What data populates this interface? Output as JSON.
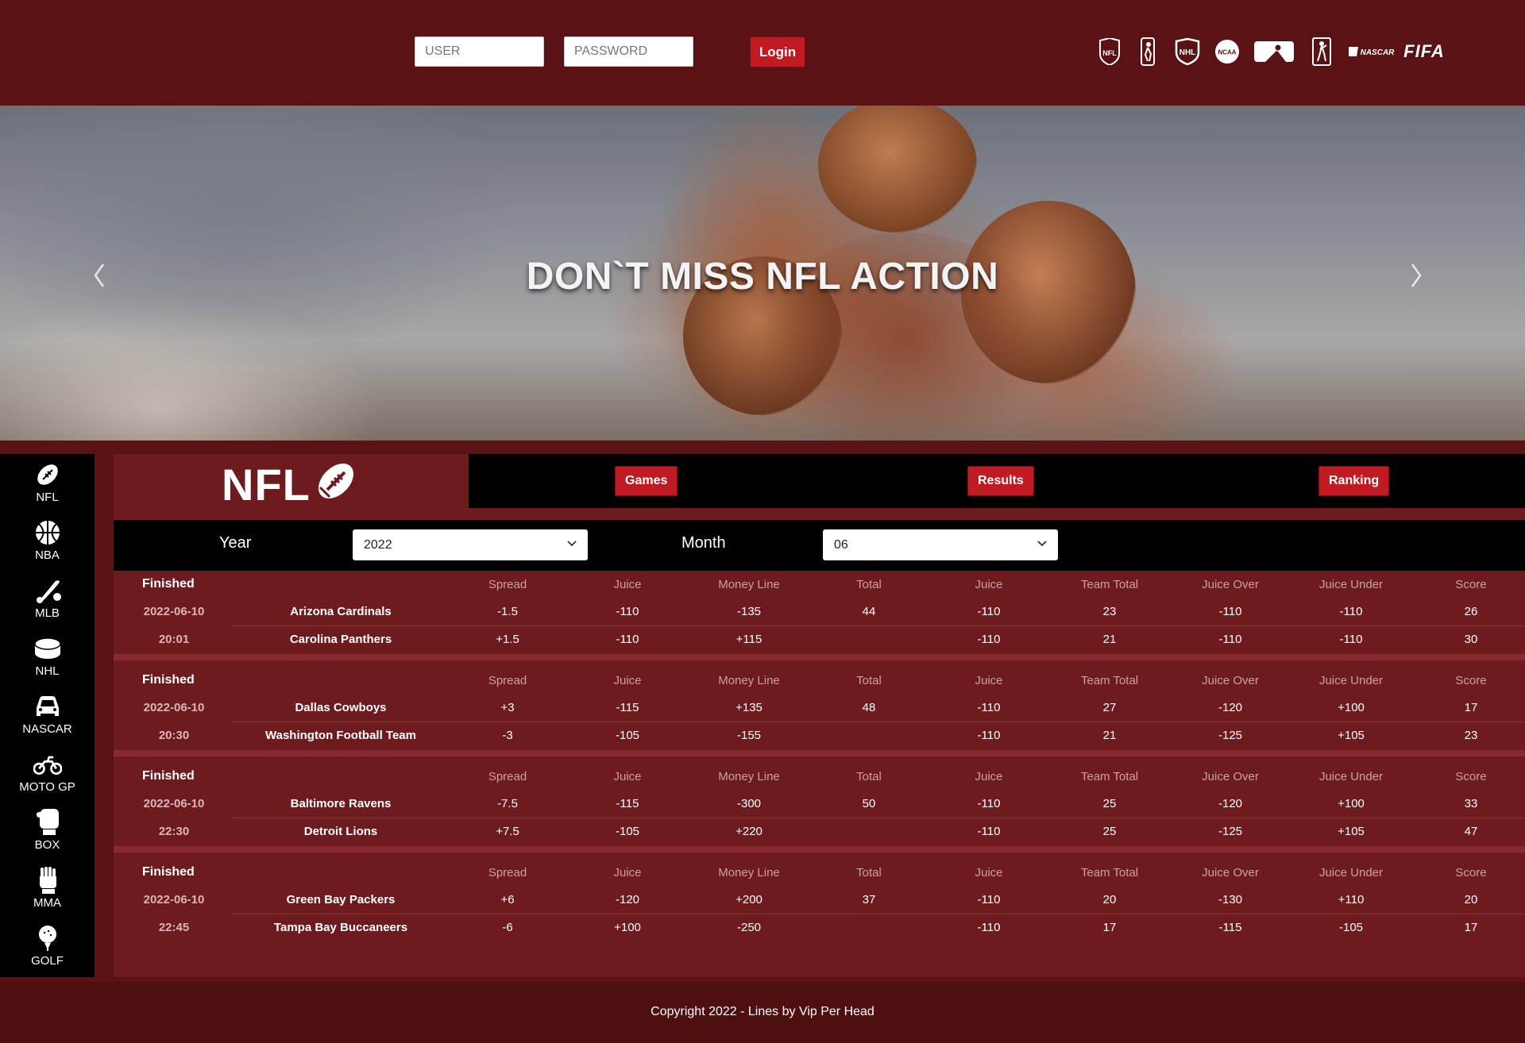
{
  "login": {
    "user_placeholder": "USER",
    "password_placeholder": "PASSWORD",
    "login_label": "Login"
  },
  "league_logos": [
    "nfl-logo",
    "nba-logo",
    "nhl-logo",
    "ncaa-logo",
    "mlb-logo",
    "pga-logo",
    "nascar-logo",
    "fifa-logo"
  ],
  "league_logo_text": {
    "fifa": "FIFA",
    "ncaa": "NCAA",
    "nascar": "NASCAR"
  },
  "hero": {
    "title": "DON`T MISS NFL ACTION"
  },
  "sidebar": {
    "items": [
      {
        "label": "NFL",
        "icon": "football-icon"
      },
      {
        "label": "NBA",
        "icon": "basketball-icon"
      },
      {
        "label": "MLB",
        "icon": "baseball-icon"
      },
      {
        "label": "NHL",
        "icon": "hockey-puck-icon"
      },
      {
        "label": "NASCAR",
        "icon": "car-icon"
      },
      {
        "label": "MOTO GP",
        "icon": "motorcycle-icon"
      },
      {
        "label": "BOX",
        "icon": "boxing-glove-icon"
      },
      {
        "label": "MMA",
        "icon": "mma-glove-icon"
      },
      {
        "label": "GOLF",
        "icon": "golf-ball-icon"
      }
    ]
  },
  "panel": {
    "league_title": "NFL",
    "tabs": [
      "Games",
      "Results",
      "Ranking"
    ],
    "filters": {
      "year_label": "Year",
      "year_value": "2022",
      "month_label": "Month",
      "month_value": "06"
    },
    "columns": [
      "Spread",
      "Juice",
      "Money Line",
      "Total",
      "Juice",
      "Team Total",
      "Juice Over",
      "Juice Under",
      "Score"
    ],
    "games": [
      {
        "status": "Finished",
        "date": "2022-06-10",
        "time": "20:01",
        "teams": [
          {
            "name": "Arizona Cardinals",
            "values": [
              "-1.5",
              "-110",
              "-135",
              "44",
              "-110",
              "23",
              "-110",
              "-110",
              "26"
            ]
          },
          {
            "name": "Carolina Panthers",
            "values": [
              "+1.5",
              "-110",
              "+115",
              "",
              "-110",
              "21",
              "-110",
              "-110",
              "30"
            ]
          }
        ]
      },
      {
        "status": "Finished",
        "date": "2022-06-10",
        "time": "20:30",
        "teams": [
          {
            "name": "Dallas Cowboys",
            "values": [
              "+3",
              "-115",
              "+135",
              "48",
              "-110",
              "27",
              "-120",
              "+100",
              "17"
            ]
          },
          {
            "name": "Washington Football Team",
            "values": [
              "-3",
              "-105",
              "-155",
              "",
              "-110",
              "21",
              "-125",
              "+105",
              "23"
            ]
          }
        ]
      },
      {
        "status": "Finished",
        "date": "2022-06-10",
        "time": "22:30",
        "teams": [
          {
            "name": "Baltimore Ravens",
            "values": [
              "-7.5",
              "-115",
              "-300",
              "50",
              "-110",
              "25",
              "-120",
              "+100",
              "33"
            ]
          },
          {
            "name": "Detroit Lions",
            "values": [
              "+7.5",
              "-105",
              "+220",
              "",
              "-110",
              "25",
              "-125",
              "+105",
              "47"
            ]
          }
        ]
      },
      {
        "status": "Finished",
        "date": "2022-06-10",
        "time": "22:45",
        "teams": [
          {
            "name": "Green Bay Packers",
            "values": [
              "+6",
              "-120",
              "+200",
              "37",
              "-110",
              "20",
              "-130",
              "+110",
              "20"
            ]
          },
          {
            "name": "Tampa Bay Buccaneers",
            "values": [
              "-6",
              "+100",
              "-250",
              "",
              "-110",
              "17",
              "-115",
              "-105",
              "17"
            ]
          }
        ]
      }
    ]
  },
  "footer": {
    "copyright": "Copyright 2022 - Lines by Vip Per Head"
  },
  "colors": {
    "header_bg": "#5a1214",
    "panel_bg": "#6e1b1f",
    "button_red": "#c11a22",
    "sidebar_bg": "#000000"
  }
}
